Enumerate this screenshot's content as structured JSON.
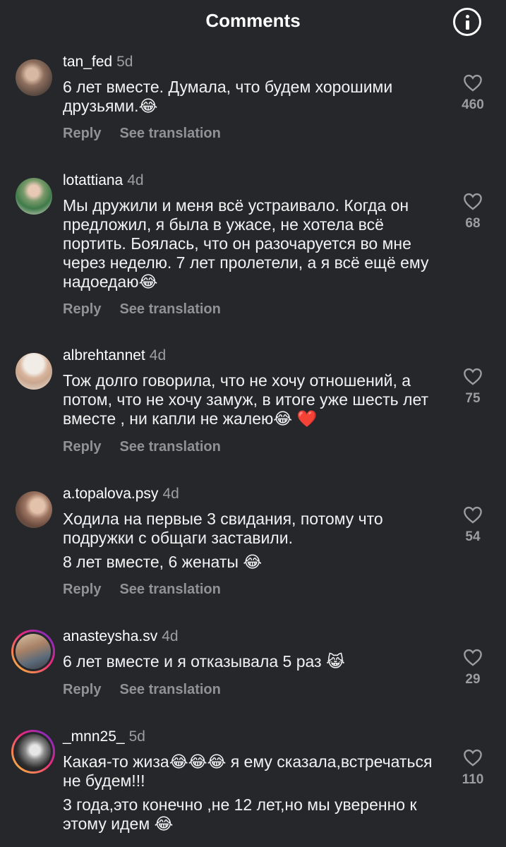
{
  "header": {
    "title": "Comments",
    "info_icon": "info-circle-icon"
  },
  "comments": [
    {
      "username": "tan_fed",
      "time": "5d",
      "text": [
        "6 лет вместе. Думала, что будем хорошими друзьями.😂"
      ],
      "reply_label": "Reply",
      "translate_label": "See translation",
      "likes": "460"
    },
    {
      "username": "lotattiana",
      "time": "4d",
      "text": [
        "Мы дружили и меня всё устраивало. Когда он предложил, я была в ужасе, не хотела всё портить. Боялась, что он разочаруется во мне через неделю. 7 лет пролетели, а я всё ещё ему надоедаю😂"
      ],
      "reply_label": "Reply",
      "translate_label": "See translation",
      "likes": "68"
    },
    {
      "username": "albrehtannet",
      "time": "4d",
      "text": [
        "Тож долго говорила, что не хочу отношений, а потом, что не хочу замуж, в итоге уже шесть лет вместе , ни капли не жалею😂 ❤️"
      ],
      "reply_label": "Reply",
      "translate_label": "See translation",
      "likes": "75"
    },
    {
      "username": "a.topalova.psy",
      "time": "4d",
      "text": [
        "Ходила на первые 3 свидания, потому что подружки с общаги заставили.",
        "8 лет вместе, 6 женаты 😂"
      ],
      "reply_label": "Reply",
      "translate_label": "See translation",
      "likes": "54"
    },
    {
      "username": "anasteysha.sv",
      "time": "4d",
      "text": [
        "6 лет вместе и я отказывала 5 раз 😹"
      ],
      "reply_label": "Reply",
      "translate_label": "See translation",
      "likes": "29"
    },
    {
      "username": "_mnn25_",
      "time": "5d",
      "text": [
        "Какая-то жиза😂😂😂 я ему сказала,встречаться не будем!!!",
        "3 года,это конечно ,не 12 лет,но мы уверенно к этому идем 😂"
      ],
      "likes": "110"
    }
  ],
  "colors": {
    "background": "#25272b",
    "text": "#f2f2f2",
    "muted": "#8f9296",
    "story_ring": "#ee2a7b"
  }
}
